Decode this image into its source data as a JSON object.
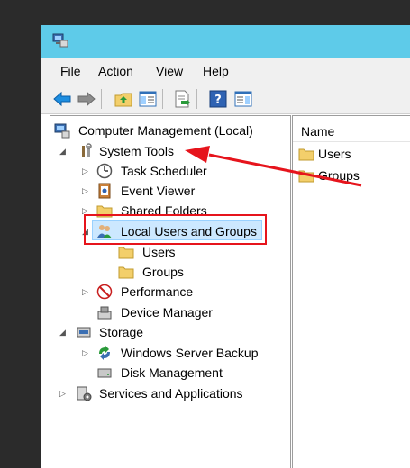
{
  "menu": [
    "File",
    "Action",
    "View",
    "Help"
  ],
  "tree": {
    "root": "Computer Management (Local)",
    "system_tools": "System Tools",
    "task_scheduler": "Task Scheduler",
    "event_viewer": "Event Viewer",
    "shared_folders": "Shared Folders",
    "local_users_groups": "Local Users and Groups",
    "users": "Users",
    "groups": "Groups",
    "performance": "Performance",
    "device_manager": "Device Manager",
    "storage": "Storage",
    "backup": "Windows Server Backup",
    "disk_management": "Disk Management",
    "services_apps": "Services and Applications"
  },
  "details": {
    "column": "Name",
    "items": [
      "Users",
      "Groups"
    ]
  },
  "colors": {
    "titlebar": "#5ecbe9",
    "annotation": "#e6141c",
    "folder": "#f3cf6b"
  }
}
